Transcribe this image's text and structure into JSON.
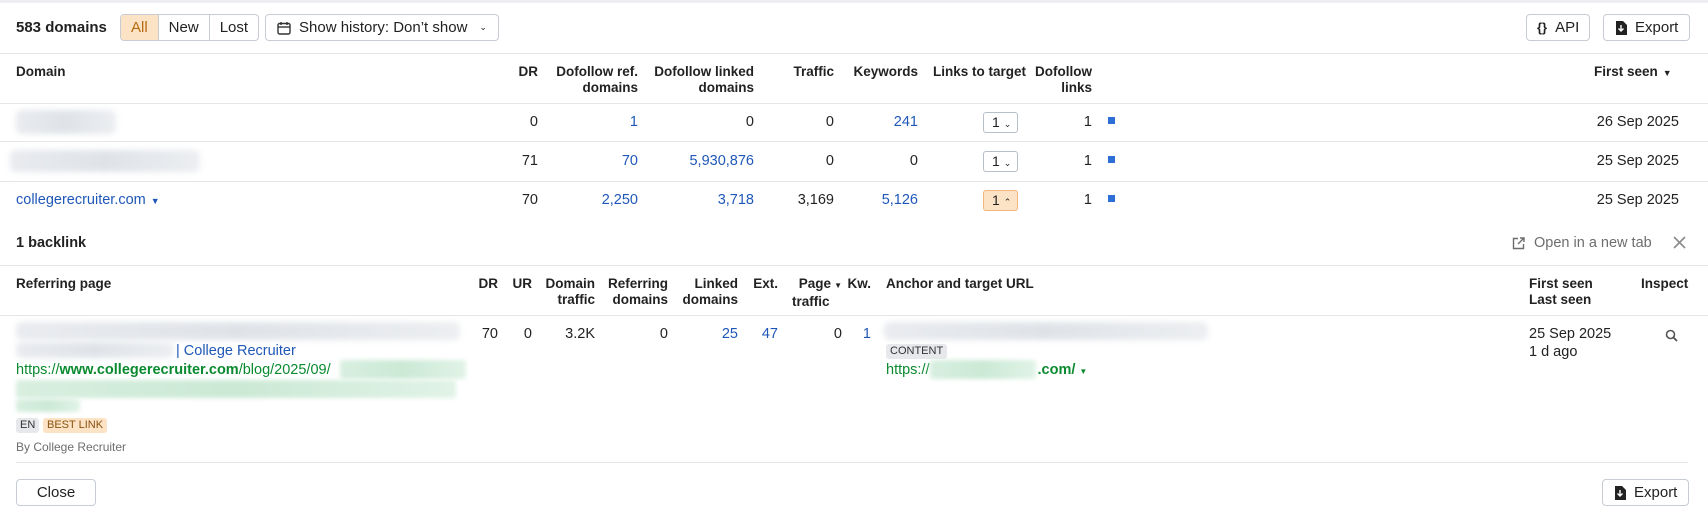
{
  "toolbar": {
    "domain_count": "583 domains",
    "filters": [
      "All",
      "New",
      "Lost"
    ],
    "active_filter": "All",
    "history_label": "Show history: Don’t show",
    "api_label": "API",
    "export_label": "Export",
    "api_glyph": "{}"
  },
  "table": {
    "headers": {
      "domain": "Domain",
      "dr": "DR",
      "dofollow_ref_1": "Dofollow ref.",
      "dofollow_ref_2": "domains",
      "dofollow_linked_1": "Dofollow linked",
      "dofollow_linked_2": "domains",
      "traffic": "Traffic",
      "keywords": "Keywords",
      "links_to_target": "Links to target",
      "dofollow_links_1": "Dofollow",
      "dofollow_links_2": "links",
      "first_seen": "First seen"
    },
    "rows": [
      {
        "domain": "",
        "dr": "0",
        "ref_domains": "1",
        "linked_domains": "0",
        "traffic": "0",
        "keywords": "241",
        "links_to_target": "1",
        "dofollow_links": "1",
        "first_seen": "26 Sep 2025"
      },
      {
        "domain": "",
        "dr": "71",
        "ref_domains": "70",
        "linked_domains": "5,930,876",
        "traffic": "0",
        "keywords": "0",
        "links_to_target": "1",
        "dofollow_links": "1",
        "first_seen": "25 Sep 2025"
      },
      {
        "domain": "collegerecruiter.com",
        "dr": "70",
        "ref_domains": "2,250",
        "linked_domains": "3,718",
        "traffic": "3,169",
        "keywords": "5,126",
        "links_to_target": "1",
        "dofollow_links": "1",
        "first_seen": "25 Sep 2025"
      }
    ]
  },
  "backlinks": {
    "title": "1 backlink",
    "open_new_tab": "Open in a new tab",
    "headers": {
      "referring_page": "Referring page",
      "dr": "DR",
      "ur": "UR",
      "domain_traffic_1": "Domain",
      "domain_traffic_2": "traffic",
      "referring_domains_1": "Referring",
      "referring_domains_2": "domains",
      "linked_domains_1": "Linked",
      "linked_domains_2": "domains",
      "ext": "Ext.",
      "page_traffic_1": "Page",
      "page_traffic_2": "traffic",
      "kw": "Kw.",
      "anchor": "Anchor and target URL",
      "first_seen": "First seen",
      "last_seen": "Last seen",
      "inspect": "Inspect"
    },
    "row": {
      "title_suffix": "| College Recruiter",
      "url_prefix": "https://",
      "url_domain": "www.collegerecruiter.com",
      "url_path": "/blog/2025/09/",
      "lang_tag": "EN",
      "best_tag": "BEST LINK",
      "by": "By College Recruiter",
      "dr": "70",
      "ur": "0",
      "domain_traffic": "3.2K",
      "referring_domains": "0",
      "linked_domains": "25",
      "ext": "47",
      "page_traffic": "0",
      "kw": "1",
      "anchor_tag": "CONTENT",
      "target_prefix": "https://",
      "target_suffix": ".com/",
      "first_seen": "25 Sep 2025",
      "last_seen": "1 d ago"
    },
    "close_label": "Close",
    "export_label": "Export"
  }
}
